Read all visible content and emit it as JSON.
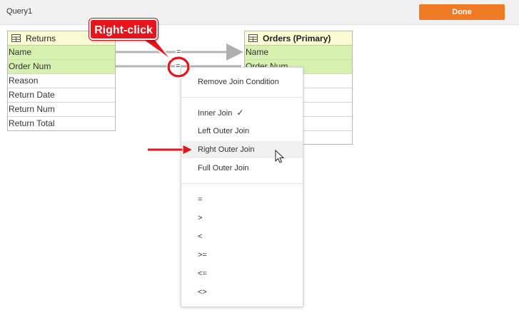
{
  "header": {
    "title": "Query1",
    "done_label": "Done"
  },
  "tables": {
    "returns": {
      "name": "Returns",
      "icon": "table-icon",
      "fields": [
        "Name",
        "Order Num",
        "Reason",
        "Return Date",
        "Return Num",
        "Return Total"
      ],
      "joined_fields": [
        "Name",
        "Order Num"
      ]
    },
    "orders": {
      "name": "Orders (Primary)",
      "icon": "table-icon",
      "fields": [
        "Name",
        "Order Num"
      ],
      "joined_fields": [
        "Name",
        "Order Num"
      ]
    }
  },
  "joins": [
    {
      "from": "Name",
      "to": "Name",
      "operator": "="
    },
    {
      "from": "Order Num",
      "to": "Order Num",
      "operator": "="
    }
  ],
  "context_menu": {
    "remove_label": "Remove Join Condition",
    "join_types": [
      {
        "label": "Inner Join",
        "checked": true
      },
      {
        "label": "Left Outer Join",
        "checked": false
      },
      {
        "label": "Right Outer Join",
        "checked": false,
        "highlighted": true
      },
      {
        "label": "Full Outer Join",
        "checked": false
      }
    ],
    "check_mark": "✓",
    "operators": [
      "=",
      ">",
      "<",
      ">=",
      "<=",
      "<>"
    ]
  },
  "annotation": {
    "callout_text": "Right-click",
    "color": "#e8141c"
  },
  "colors": {
    "accent": "#f07b24",
    "header_bg": "#fbfbd4",
    "joined_row_bg": "#d6f0b0"
  }
}
